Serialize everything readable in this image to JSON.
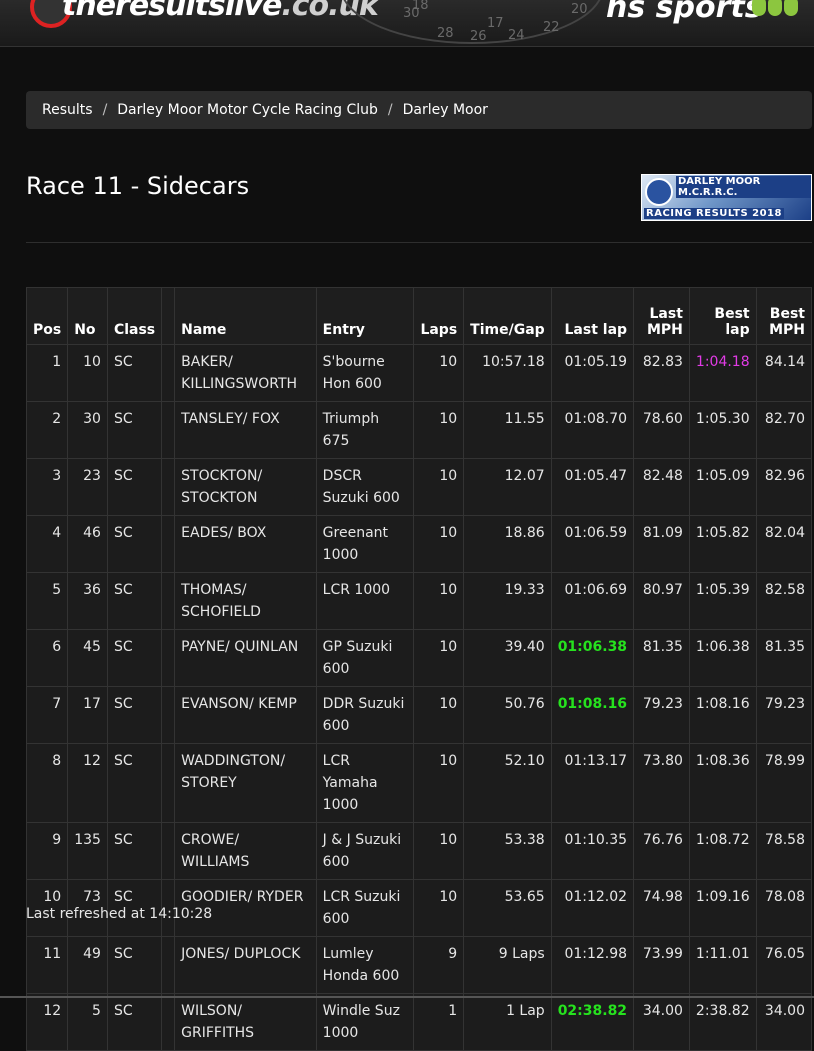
{
  "header": {
    "site_name_main": "theresultslive",
    "site_name_domain": ".co.uk",
    "sponsor": "hs sports",
    "dial_numbers": [
      "18",
      "17",
      "30",
      "28",
      "26",
      "24",
      "22",
      "20"
    ]
  },
  "breadcrumb": [
    "Results",
    "Darley Moor Motor Cycle Racing Club",
    "Darley Moor"
  ],
  "page_title": "Race 11 - Sidecars",
  "badge": {
    "line1": "DARLEY MOOR M.C.R.R.C.",
    "line2": "RACING RESULTS 2018"
  },
  "table": {
    "headers": [
      "Pos",
      "No",
      "Class",
      "",
      "Name",
      "Entry",
      "Laps",
      "Time/Gap",
      "Last lap",
      "Last MPH",
      "Best lap",
      "Best MPH"
    ],
    "rows": [
      {
        "pos": "1",
        "no": "10",
        "cls": "SC",
        "name": "BAKER/ KILLINGSWORTH",
        "entry": "S'bourne Hon 600",
        "laps": "10",
        "gap": "10:57.18",
        "last_lap": "01:05.19",
        "last_mph": "82.83",
        "best_lap": "1:04.18",
        "best_mph": "84.14"
      },
      {
        "pos": "2",
        "no": "30",
        "cls": "SC",
        "name": "TANSLEY/ FOX",
        "entry": "Triumph 675",
        "laps": "10",
        "gap": "11.55",
        "last_lap": "01:08.70",
        "last_mph": "78.60",
        "best_lap": "1:05.30",
        "best_mph": "82.70"
      },
      {
        "pos": "3",
        "no": "23",
        "cls": "SC",
        "name": "STOCKTON/ STOCKTON",
        "entry": "DSCR Suzuki 600",
        "laps": "10",
        "gap": "12.07",
        "last_lap": "01:05.47",
        "last_mph": "82.48",
        "best_lap": "1:05.09",
        "best_mph": "82.96"
      },
      {
        "pos": "4",
        "no": "46",
        "cls": "SC",
        "name": "EADES/ BOX",
        "entry": "Greenant 1000",
        "laps": "10",
        "gap": "18.86",
        "last_lap": "01:06.59",
        "last_mph": "81.09",
        "best_lap": "1:05.82",
        "best_mph": "82.04"
      },
      {
        "pos": "5",
        "no": "36",
        "cls": "SC",
        "name": "THOMAS/ SCHOFIELD",
        "entry": "LCR 1000",
        "laps": "10",
        "gap": "19.33",
        "last_lap": "01:06.69",
        "last_mph": "80.97",
        "best_lap": "1:05.39",
        "best_mph": "82.58"
      },
      {
        "pos": "6",
        "no": "45",
        "cls": "SC",
        "name": "PAYNE/ QUINLAN",
        "entry": "GP Suzuki 600",
        "laps": "10",
        "gap": "39.40",
        "last_lap": "01:06.38",
        "last_mph": "81.35",
        "best_lap": "1:06.38",
        "best_mph": "81.35"
      },
      {
        "pos": "7",
        "no": "17",
        "cls": "SC",
        "name": "EVANSON/ KEMP",
        "entry": "DDR Suzuki 600",
        "laps": "10",
        "gap": "50.76",
        "last_lap": "01:08.16",
        "last_mph": "79.23",
        "best_lap": "1:08.16",
        "best_mph": "79.23"
      },
      {
        "pos": "8",
        "no": "12",
        "cls": "SC",
        "name": "WADDINGTON/ STOREY",
        "entry": "LCR Yamaha 1000",
        "laps": "10",
        "gap": "52.10",
        "last_lap": "01:13.17",
        "last_mph": "73.80",
        "best_lap": "1:08.36",
        "best_mph": "78.99"
      },
      {
        "pos": "9",
        "no": "135",
        "cls": "SC",
        "name": "CROWE/ WILLIAMS",
        "entry": "J & J Suzuki 600",
        "laps": "10",
        "gap": "53.38",
        "last_lap": "01:10.35",
        "last_mph": "76.76",
        "best_lap": "1:08.72",
        "best_mph": "78.58"
      },
      {
        "pos": "10",
        "no": "73",
        "cls": "SC",
        "name": "GOODIER/ RYDER",
        "entry": "LCR Suzuki 600",
        "laps": "10",
        "gap": "53.65",
        "last_lap": "01:12.02",
        "last_mph": "74.98",
        "best_lap": "1:09.16",
        "best_mph": "78.08"
      },
      {
        "pos": "11",
        "no": "49",
        "cls": "SC",
        "name": "JONES/ DUPLOCK",
        "entry": "Lumley Honda 600",
        "laps": "9",
        "gap": "9 Laps",
        "last_lap": "01:12.98",
        "last_mph": "73.99",
        "best_lap": "1:11.01",
        "best_mph": "76.05"
      },
      {
        "pos": "12",
        "no": "5",
        "cls": "SC",
        "name": "WILSON/ GRIFFITHS",
        "entry": "Windle Suz 1000",
        "laps": "1",
        "gap": "1 Lap",
        "last_lap": "02:38.82",
        "last_mph": "34.00",
        "best_lap": "2:38.82",
        "best_mph": "34.00"
      }
    ],
    "highlight": {
      "green_last_lap_rows": [
        6,
        7,
        12
      ],
      "purple_best_lap_rows": [
        1
      ],
      "green_color": "#26e21e",
      "purple_color": "#e23be6"
    }
  },
  "footer": {
    "refreshed": "Last refreshed at 14:10:28"
  }
}
